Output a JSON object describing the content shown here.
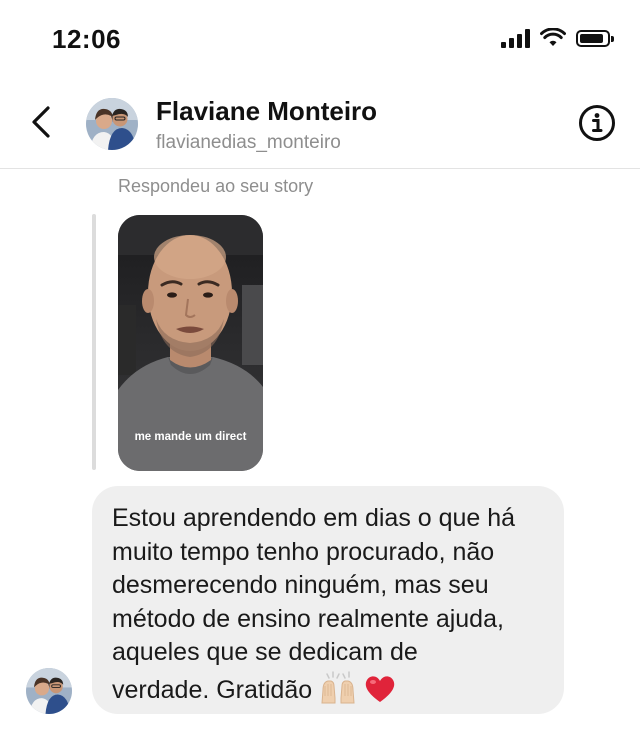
{
  "status_bar": {
    "time": "12:06",
    "battery_level": 0.9
  },
  "header": {
    "back_icon": "chevron-left-icon",
    "name": "Flaviane Monteiro",
    "handle": "flavianedias_monteiro",
    "info_icon": "info-circle-icon"
  },
  "story_reply": {
    "caption": "Respondeu ao seu story",
    "story_text": "me mande um direct"
  },
  "message": {
    "text": "Estou aprendendo em dias o que há\nmuito tempo tenho procurado, não\ndesmerecendo ninguém, mas seu\nmétodo de ensino realmente ajuda,\naqueles que se dedicam de\nverdade. Gratidão ",
    "emojis": [
      "raising-hands-icon",
      "red-heart-icon"
    ],
    "bubble_color": "#efefef"
  }
}
